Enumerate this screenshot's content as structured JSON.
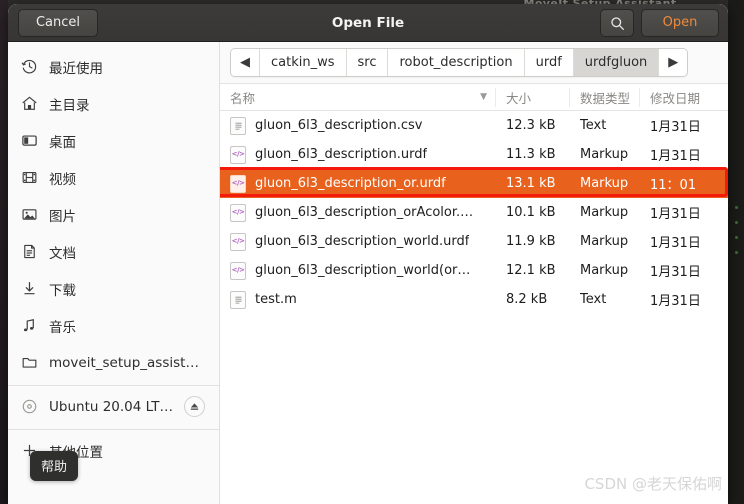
{
  "desktop": {
    "background_window_title": "MoveIt Setup Assistant"
  },
  "header": {
    "cancel_label": "Cancel",
    "title": "Open File",
    "search_icon": "search-icon",
    "open_label": "Open",
    "accent_color": "#f18a3a",
    "background_color": "#3a3937"
  },
  "sidebar": {
    "items": [
      {
        "icon": "recent-clock-icon",
        "label": "最近使用"
      },
      {
        "icon": "home-icon",
        "label": "主目录"
      },
      {
        "icon": "desktop-icon",
        "label": "桌面"
      },
      {
        "icon": "video-film-icon",
        "label": "视频"
      },
      {
        "icon": "image-picture-icon",
        "label": "图片"
      },
      {
        "icon": "document-icon",
        "label": "文档"
      },
      {
        "icon": "download-arrow-icon",
        "label": "下载"
      },
      {
        "icon": "music-note-icon",
        "label": "音乐"
      },
      {
        "icon": "folder-icon",
        "label": "moveit_setup_assistant"
      }
    ],
    "devices": [
      {
        "icon": "disc-icon",
        "label": "Ubuntu 20.04 LT…",
        "eject_icon": "eject-icon"
      }
    ],
    "other_locations": {
      "icon": "plus-icon",
      "label": "其他位置"
    },
    "tooltip": "帮助"
  },
  "main": {
    "breadcrumb": {
      "back_arrow": "◀",
      "forward_arrow": "▶",
      "items": [
        {
          "label": "catkin_ws",
          "active": false
        },
        {
          "label": "src",
          "active": false
        },
        {
          "label": "robot_description",
          "active": false
        },
        {
          "label": "urdf",
          "active": false
        },
        {
          "label": "urdfgluon",
          "active": true
        }
      ]
    },
    "columns": {
      "name": "名称",
      "sort_caret": "▼",
      "size": "大小",
      "type": "数据类型",
      "date": "修改日期"
    },
    "files": [
      {
        "icon": "text-file-icon",
        "name": "gluon_6l3_description.csv",
        "size": "12.3 kB",
        "type": "Text",
        "date": "1月31日",
        "selected": false
      },
      {
        "icon": "markup-file-icon",
        "name": "gluon_6l3_description.urdf",
        "size": "11.3 kB",
        "type": "Markup",
        "date": "1月31日",
        "selected": false
      },
      {
        "icon": "markup-file-icon",
        "name": "gluon_6l3_description_or.urdf",
        "size": "13.1 kB",
        "type": "Markup",
        "date": "11：01",
        "selected": true
      },
      {
        "icon": "markup-file-icon",
        "name": "gluon_6l3_description_orAcolor.…",
        "size": "10.1 kB",
        "type": "Markup",
        "date": "1月31日",
        "selected": false
      },
      {
        "icon": "markup-file-icon",
        "name": "gluon_6l3_description_world.urdf",
        "size": "11.9 kB",
        "type": "Markup",
        "date": "1月31日",
        "selected": false
      },
      {
        "icon": "markup-file-icon",
        "name": "gluon_6l3_description_world(or…",
        "size": "12.1 kB",
        "type": "Markup",
        "date": "1月31日",
        "selected": false
      },
      {
        "icon": "text-file-icon",
        "name": "test.m",
        "size": "8.2 kB",
        "type": "Text",
        "date": "1月31日",
        "selected": false
      }
    ],
    "selection_color": "#e8621e",
    "annotation_color": "#f41b0c"
  },
  "watermark": "CSDN @老天保佑啊"
}
